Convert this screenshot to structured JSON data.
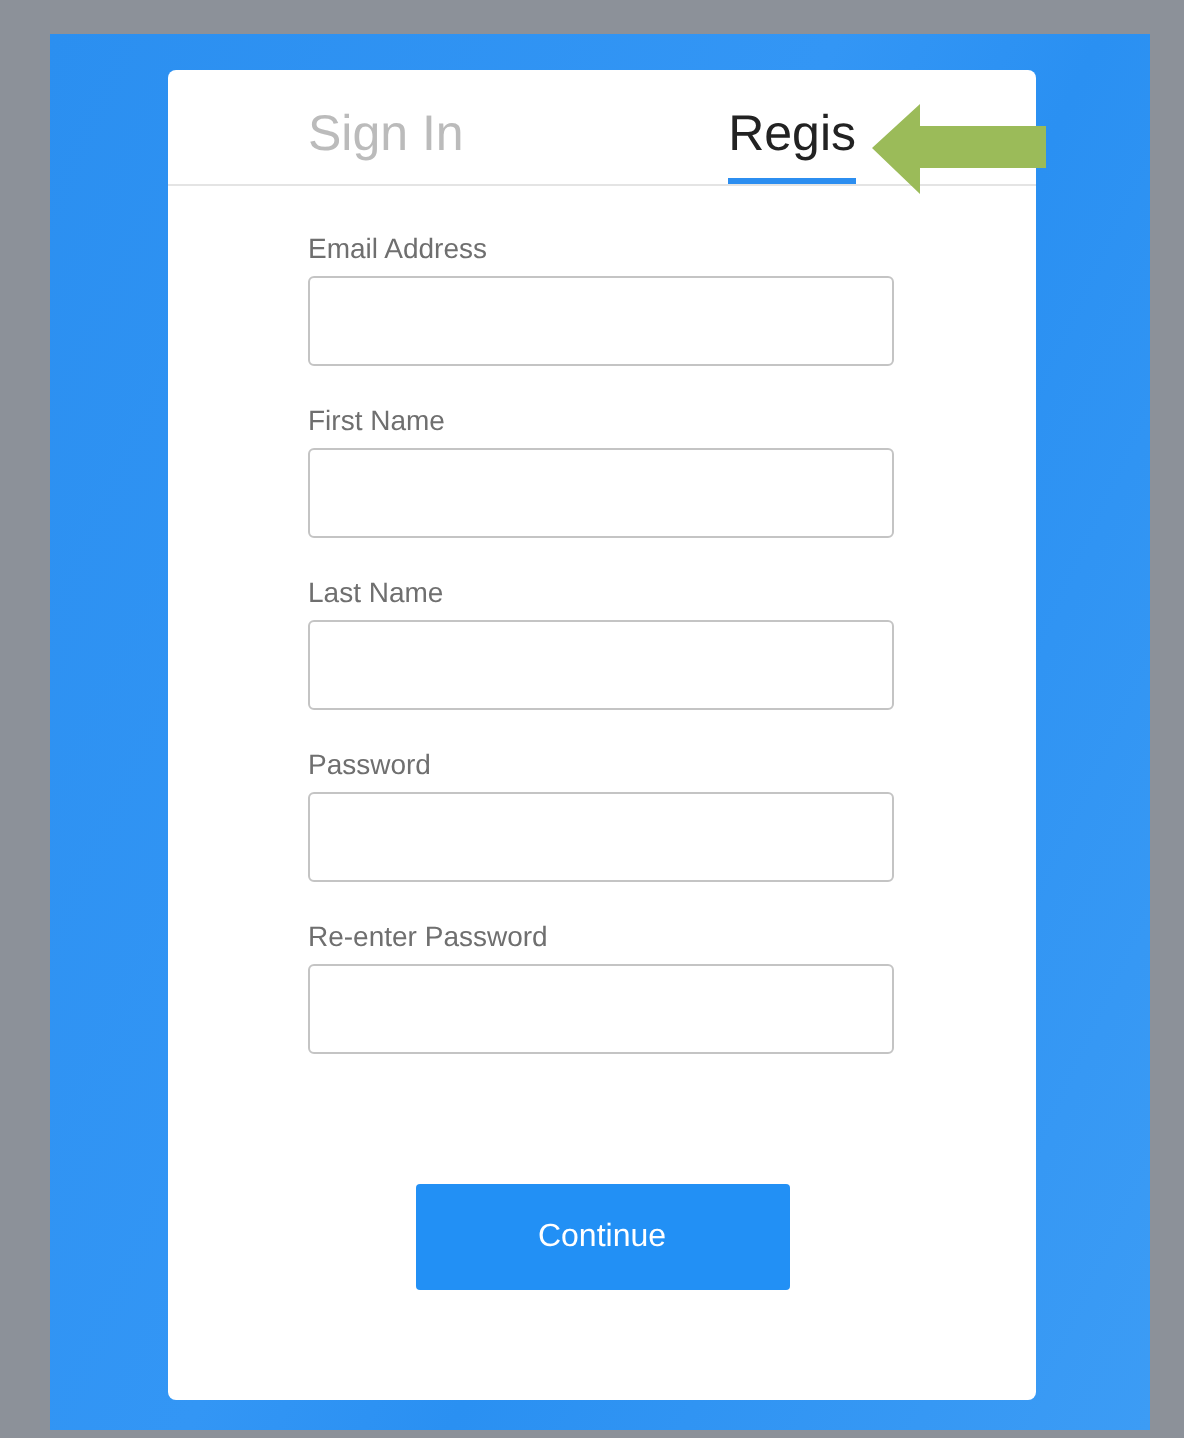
{
  "tabs": [
    {
      "label": "Sign In",
      "selected": false
    },
    {
      "label": "Regis",
      "selected": true
    }
  ],
  "fields": [
    {
      "label": "Email Address"
    },
    {
      "label": "First Name"
    },
    {
      "label": "Last Name"
    },
    {
      "label": "Password"
    },
    {
      "label": "Re-enter Password"
    }
  ],
  "button": "Continue"
}
